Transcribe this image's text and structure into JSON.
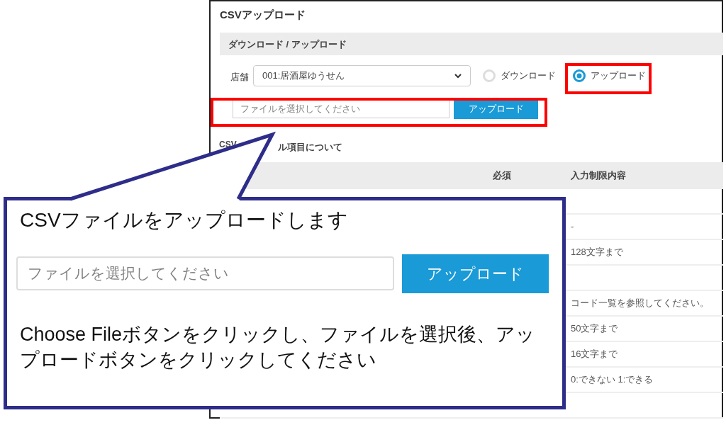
{
  "page": {
    "title": "CSVアップロード",
    "section": "ダウンロード / アップロード",
    "store_label": "店舗",
    "store_select": "001:居酒屋ゆうせん",
    "modes": [
      {
        "label": "ダウンロード",
        "selected": false,
        "highlighted": false
      },
      {
        "label": "アップロード",
        "selected": true,
        "highlighted": true
      }
    ],
    "file_row": {
      "highlighted": true,
      "placeholder": "ファイルを選択してください",
      "button": "アップロード"
    },
    "fields_heading": [
      "CSV",
      "ル項目について"
    ],
    "table": {
      "columns": [
        "必須",
        "入力制限内容"
      ],
      "rows": [
        {},
        {
          "limit": "-"
        },
        {
          "limit": "128文字まで"
        },
        {},
        {
          "limit": "コード一覧を参照してください。"
        },
        {
          "limit": "50文字まで"
        },
        {
          "limit": "16文字まで"
        },
        {
          "limit": "0:できない 1:できる"
        },
        {}
      ]
    }
  },
  "callout": {
    "title": "CSVファイルをアップロードします",
    "placeholder": "ファイルを選択してください",
    "button": "アップロード",
    "instructions": "Choose Fileボタンをクリックし、ファイルを選択後、アップロードボタンをクリックしてください"
  }
}
